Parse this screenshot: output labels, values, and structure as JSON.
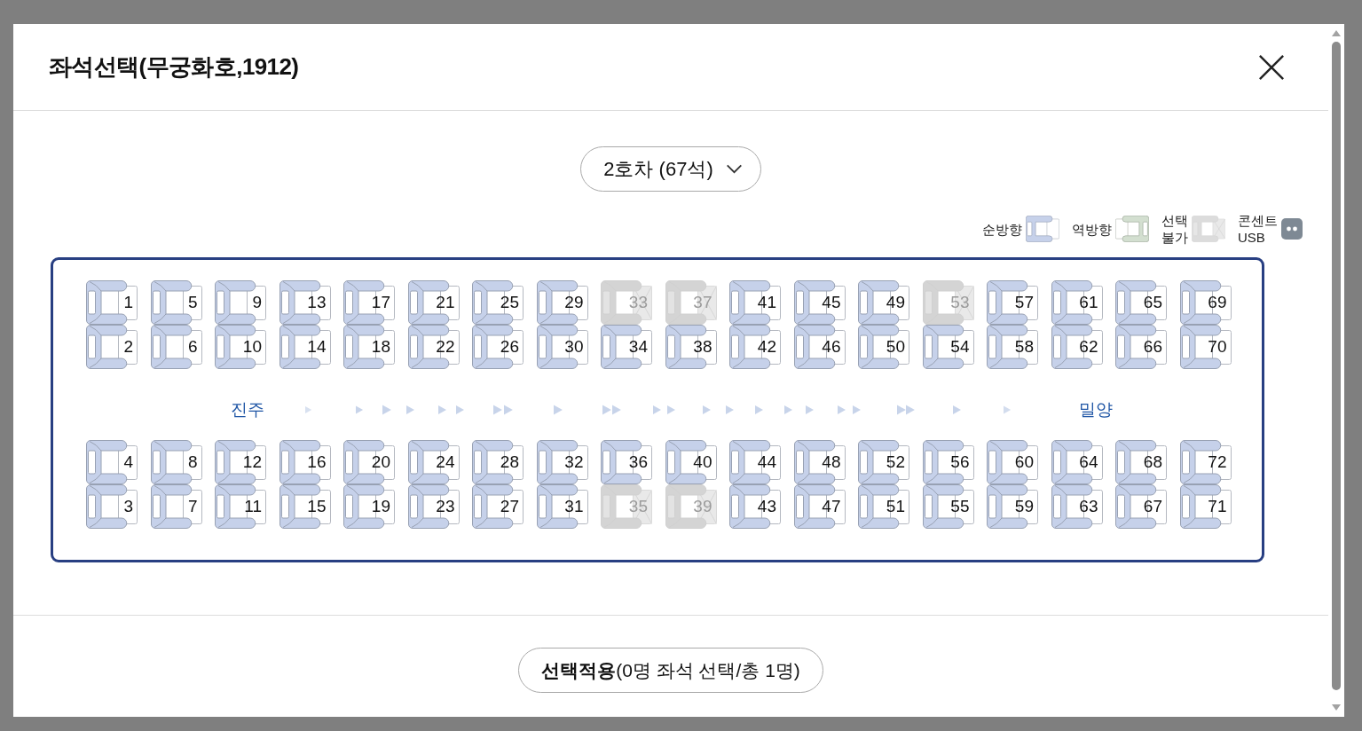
{
  "dialog": {
    "title": "좌석선택(무궁화호,1912)"
  },
  "car_selector": {
    "label": "2호차 (67석)"
  },
  "legend": [
    {
      "kind": "forward",
      "label": "순방향"
    },
    {
      "kind": "backward",
      "label": "역방향"
    },
    {
      "kind": "unavailable",
      "label": "선택 불가"
    },
    {
      "kind": "outlet",
      "label": "콘센트 USB"
    }
  ],
  "seat_map": {
    "upper_rows": [
      [
        {
          "number": "1",
          "available": true
        },
        {
          "number": "5",
          "available": true
        },
        {
          "number": "9",
          "available": true
        },
        {
          "number": "13",
          "available": true
        },
        {
          "number": "17",
          "available": true
        },
        {
          "number": "21",
          "available": true
        },
        {
          "number": "25",
          "available": true
        },
        {
          "number": "29",
          "available": true
        },
        {
          "number": "33",
          "available": false
        },
        {
          "number": "37",
          "available": false
        },
        {
          "number": "41",
          "available": true
        },
        {
          "number": "45",
          "available": true
        },
        {
          "number": "49",
          "available": true
        },
        {
          "number": "53",
          "available": false
        },
        {
          "number": "57",
          "available": true
        },
        {
          "number": "61",
          "available": true
        },
        {
          "number": "65",
          "available": true
        },
        {
          "number": "69",
          "available": true
        }
      ],
      [
        {
          "number": "2",
          "available": true
        },
        {
          "number": "6",
          "available": true
        },
        {
          "number": "10",
          "available": true
        },
        {
          "number": "14",
          "available": true
        },
        {
          "number": "18",
          "available": true
        },
        {
          "number": "22",
          "available": true
        },
        {
          "number": "26",
          "available": true
        },
        {
          "number": "30",
          "available": true
        },
        {
          "number": "34",
          "available": true
        },
        {
          "number": "38",
          "available": true
        },
        {
          "number": "42",
          "available": true
        },
        {
          "number": "46",
          "available": true
        },
        {
          "number": "50",
          "available": true
        },
        {
          "number": "54",
          "available": true
        },
        {
          "number": "58",
          "available": true
        },
        {
          "number": "62",
          "available": true
        },
        {
          "number": "66",
          "available": true
        },
        {
          "number": "70",
          "available": true
        }
      ]
    ],
    "direction": {
      "from": "진주",
      "to": "밀양"
    },
    "lower_rows": [
      [
        {
          "number": "4",
          "available": true
        },
        {
          "number": "8",
          "available": true
        },
        {
          "number": "12",
          "available": true
        },
        {
          "number": "16",
          "available": true
        },
        {
          "number": "20",
          "available": true
        },
        {
          "number": "24",
          "available": true
        },
        {
          "number": "28",
          "available": true
        },
        {
          "number": "32",
          "available": true
        },
        {
          "number": "36",
          "available": true
        },
        {
          "number": "40",
          "available": true
        },
        {
          "number": "44",
          "available": true
        },
        {
          "number": "48",
          "available": true
        },
        {
          "number": "52",
          "available": true
        },
        {
          "number": "56",
          "available": true
        },
        {
          "number": "60",
          "available": true
        },
        {
          "number": "64",
          "available": true
        },
        {
          "number": "68",
          "available": true
        },
        {
          "number": "72",
          "available": true
        }
      ],
      [
        {
          "number": "3",
          "available": true
        },
        {
          "number": "7",
          "available": true
        },
        {
          "number": "11",
          "available": true
        },
        {
          "number": "15",
          "available": true
        },
        {
          "number": "19",
          "available": true
        },
        {
          "number": "23",
          "available": true
        },
        {
          "number": "27",
          "available": true
        },
        {
          "number": "31",
          "available": true
        },
        {
          "number": "35",
          "available": false
        },
        {
          "number": "39",
          "available": false
        },
        {
          "number": "43",
          "available": true
        },
        {
          "number": "47",
          "available": true
        },
        {
          "number": "51",
          "available": true
        },
        {
          "number": "55",
          "available": true
        },
        {
          "number": "59",
          "available": true
        },
        {
          "number": "63",
          "available": true
        },
        {
          "number": "67",
          "available": true
        },
        {
          "number": "71",
          "available": true
        }
      ]
    ]
  },
  "apply_button": {
    "label": "**선택적용**(0명 좌석 선택/총 1명)"
  }
}
